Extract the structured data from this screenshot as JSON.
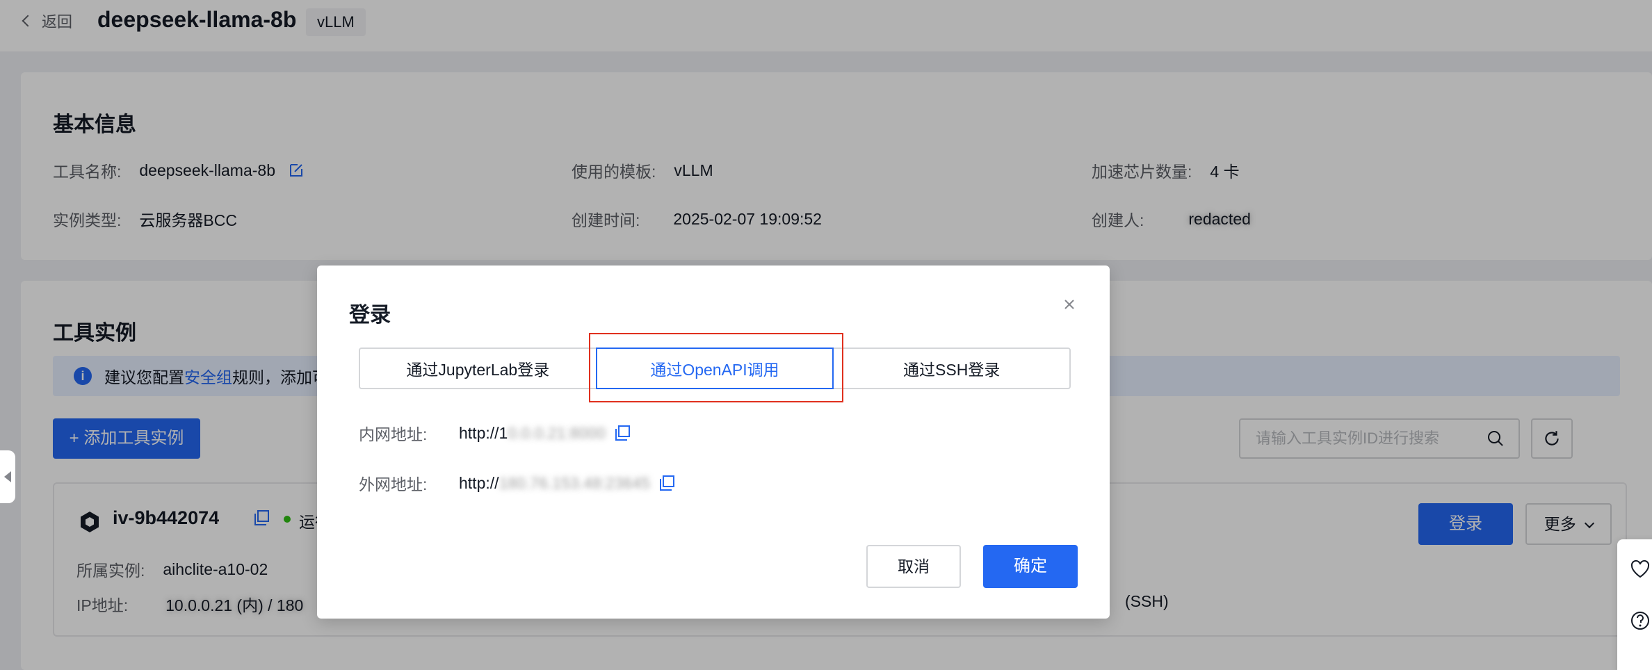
{
  "header": {
    "back_label": "返回",
    "title": "deepseek-llama-8b",
    "tag": "vLLM"
  },
  "basic_info": {
    "section_title": "基本信息",
    "tool_name_label": "工具名称:",
    "tool_name_value": "deepseek-llama-8b",
    "template_label": "使用的模板:",
    "template_value": "vLLM",
    "chips_label": "加速芯片数量:",
    "chips_value": "4 卡",
    "instance_type_label": "实例类型:",
    "instance_type_value": "云服务器BCC",
    "created_label": "创建时间:",
    "created_value": "2025-02-07 19:09:52",
    "creator_label": "创建人:",
    "creator_value": "redacted"
  },
  "instances": {
    "section_title": "工具实例",
    "notice_prefix": "建议您配置",
    "notice_link": "安全组",
    "notice_suffix": "规则，添加可",
    "add_button": "+ 添加工具实例",
    "search_placeholder": "请输入工具实例ID进行搜索",
    "instance": {
      "id": "iv-9b442074",
      "status": "运行中",
      "belong_label": "所属实例:",
      "belong_value": "aihclite-a10-02",
      "ip_label": "IP地址:",
      "ip_value": "10.0.0.21 (内) / 180",
      "ssh_suffix": "(SSH)",
      "login_button": "登录",
      "more_button": "更多"
    }
  },
  "dialog": {
    "title": "登录",
    "tabs": [
      "通过JupyterLab登录",
      "通过OpenAPI调用",
      "通过SSH登录"
    ],
    "active_tab": 1,
    "internal_label": "内网地址:",
    "internal_value": "http://10.0.0.21:8000",
    "external_label": "外网地址:",
    "external_value": "http://180.76.153.48:23645",
    "cancel_button": "取消",
    "ok_button": "确定"
  },
  "colors": {
    "primary": "#2468f2",
    "highlight_border": "#e0301e",
    "status_running": "#30bf13"
  }
}
